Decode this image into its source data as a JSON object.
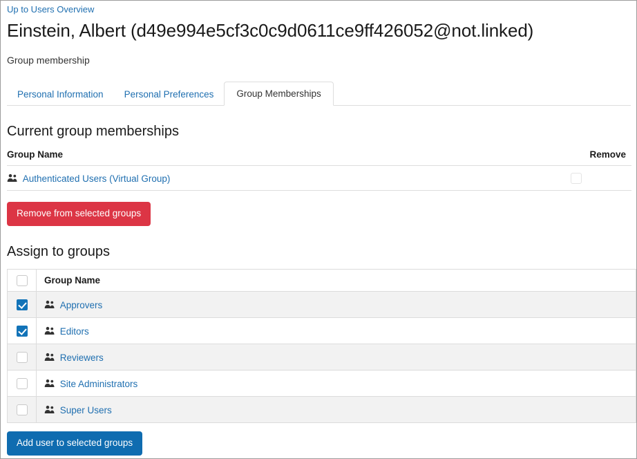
{
  "breadcrumb": {
    "label": "Up to Users Overview"
  },
  "header": {
    "title": "Einstein, Albert (d49e994e5cf3c0c9d0611ce9ff426052@not.linked)",
    "subtitle": "Group membership"
  },
  "tabs": [
    {
      "label": "Personal Information",
      "active": false
    },
    {
      "label": "Personal Preferences",
      "active": false
    },
    {
      "label": "Group Memberships",
      "active": true
    }
  ],
  "current_memberships": {
    "section_title": "Current group memberships",
    "columns": {
      "group_name": "Group Name",
      "remove": "Remove"
    },
    "rows": [
      {
        "name": "Authenticated Users (Virtual Group)",
        "icon": "people-icon",
        "remove_checked": false,
        "remove_disabled": true
      }
    ],
    "remove_button": "Remove from selected groups"
  },
  "assign_groups": {
    "section_title": "Assign to groups",
    "columns": {
      "select_all": "",
      "group_name": "Group Name"
    },
    "select_all_checked": false,
    "rows": [
      {
        "name": "Approvers",
        "icon": "people-icon",
        "checked": true
      },
      {
        "name": "Editors",
        "icon": "people-icon",
        "checked": true
      },
      {
        "name": "Reviewers",
        "icon": "people-icon",
        "checked": false
      },
      {
        "name": "Site Administrators",
        "icon": "people-icon",
        "checked": false
      },
      {
        "name": "Super Users",
        "icon": "people-icon",
        "checked": false
      }
    ],
    "add_button": "Add user to selected groups"
  },
  "colors": {
    "link": "#1f6fb0",
    "danger": "#dc3545",
    "primary": "#0f6cb0",
    "checkbox_checked": "#1273b8",
    "row_stripe": "#f2f2f2",
    "border": "#dcdcdc"
  }
}
